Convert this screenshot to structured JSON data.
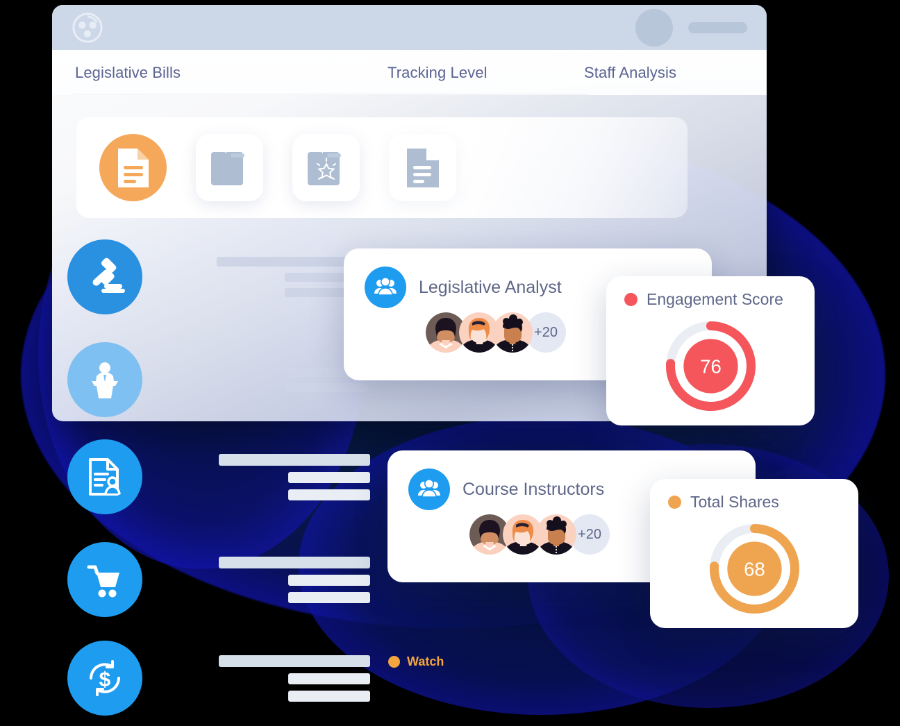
{
  "window": {
    "logo_icon": "circular-network-logo",
    "titlebar": {
      "avatar_icon": "user-avatar-placeholder",
      "bar_icon": "name-placeholder-bar"
    },
    "nav": [
      {
        "label": "Legislative Bills",
        "name": "nav-legislative-bills"
      },
      {
        "label": "Tracking Level",
        "name": "nav-tracking-level"
      },
      {
        "label": "Staff Analysis",
        "name": "nav-staff-analysis"
      }
    ],
    "tiles": [
      {
        "icon": "document-lines-icon",
        "state": "active",
        "color": "#f5a85a"
      },
      {
        "icon": "folder-icon",
        "state": "default",
        "color": "#aebdd1"
      },
      {
        "icon": "folder-star-icon",
        "state": "default",
        "color": "#aebdd1"
      },
      {
        "icon": "document-lines-icon",
        "state": "default",
        "color": "#aebdd1"
      }
    ],
    "rows": [
      {
        "icon": "gavel-icon",
        "color": "#2a90e0",
        "name": "row-gavel"
      },
      {
        "icon": "podium-speaker-icon",
        "color": "#7fc0f2",
        "name": "row-podium"
      }
    ]
  },
  "side_list": [
    {
      "icon": "document-user-icon",
      "color": "#1e9cf0",
      "name": "list-item-resume"
    },
    {
      "icon": "shopping-cart-icon",
      "color": "#1e9cf0",
      "name": "list-item-cart"
    },
    {
      "icon": "dollar-refresh-icon",
      "color": "#1e9cf0",
      "name": "list-item-refund"
    }
  ],
  "teams": [
    {
      "title": "Legislative Analyst",
      "badge_icon": "people-group-icon",
      "badge_color": "#1e9cf0",
      "overflow_label": "+20",
      "avatars": [
        "avatar-woman-bob",
        "avatar-person-ginger",
        "avatar-man-curly"
      ]
    },
    {
      "title": "Course Instructors",
      "badge_icon": "people-group-icon",
      "badge_color": "#1e9cf0",
      "overflow_label": "+20",
      "avatars": [
        "avatar-woman-bob",
        "avatar-person-ginger",
        "avatar-man-curly"
      ]
    }
  ],
  "metrics": [
    {
      "title": "Engagement Score",
      "value": "76",
      "color": "#f4565b",
      "track_color": "#eaeef4",
      "percent": 76
    },
    {
      "title": "Total Shares",
      "value": "68",
      "color": "#f0a košt",
      "track_color": "#eaeef4",
      "percent": 68
    }
  ],
  "legend": {
    "label": "Watch",
    "color": "#f3a63f",
    "dot_icon": "legend-dot-icon"
  },
  "chart_data": {
    "type": "pie",
    "title": "Score gauges",
    "series": [
      {
        "name": "Engagement Score",
        "value": 76,
        "max": 100,
        "color": "#f4565b"
      },
      {
        "name": "Total Shares",
        "value": 68,
        "max": 100,
        "color": "#efa44f"
      }
    ]
  }
}
